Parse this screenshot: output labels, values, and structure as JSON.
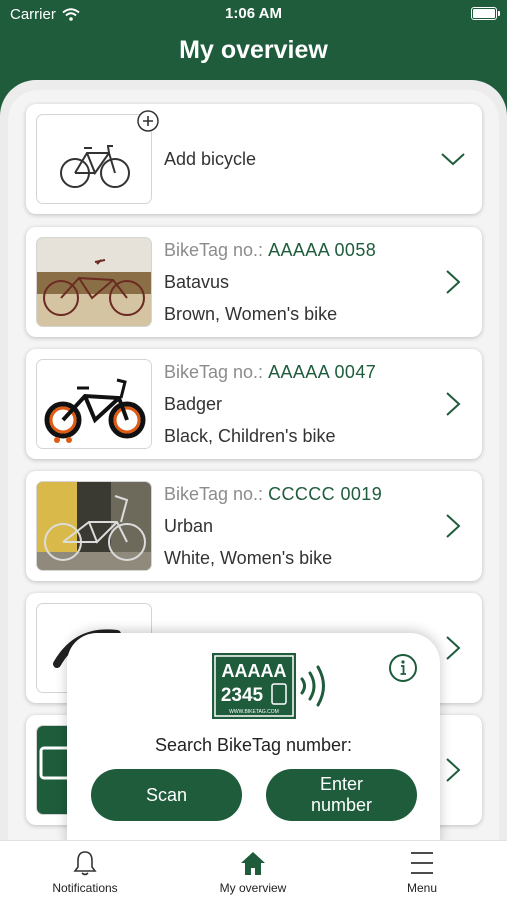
{
  "status_bar": {
    "carrier": "Carrier",
    "time": "1:06 AM"
  },
  "header": {
    "title": "My overview"
  },
  "add_card": {
    "label": "Add bicycle"
  },
  "bikes": [
    {
      "tag_label": "BikeTag no.:",
      "tag_number": "AAAAA 0058",
      "brand": "Batavus",
      "description": "Brown, Women's bike"
    },
    {
      "tag_label": "BikeTag no.:",
      "tag_number": "AAAAA 0047",
      "brand": "Badger",
      "description": "Black, Children's bike"
    },
    {
      "tag_label": "BikeTag no.:",
      "tag_number": "CCCCC 0019",
      "brand": "Urban",
      "description": "White, Women's bike"
    }
  ],
  "search_popup": {
    "logo_top": "AAAAA",
    "logo_bottom": "2345",
    "logo_url": "WWW.BIKETAG.COM",
    "prompt": "Search BikeTag number:",
    "scan_label": "Scan",
    "enter_label_line1": "Enter",
    "enter_label_line2": "number"
  },
  "tabbar": {
    "notifications": "Notifications",
    "overview": "My overview",
    "menu": "Menu"
  },
  "colors": {
    "brand_green": "#1e5c3c",
    "background": "#f4f4f4"
  }
}
